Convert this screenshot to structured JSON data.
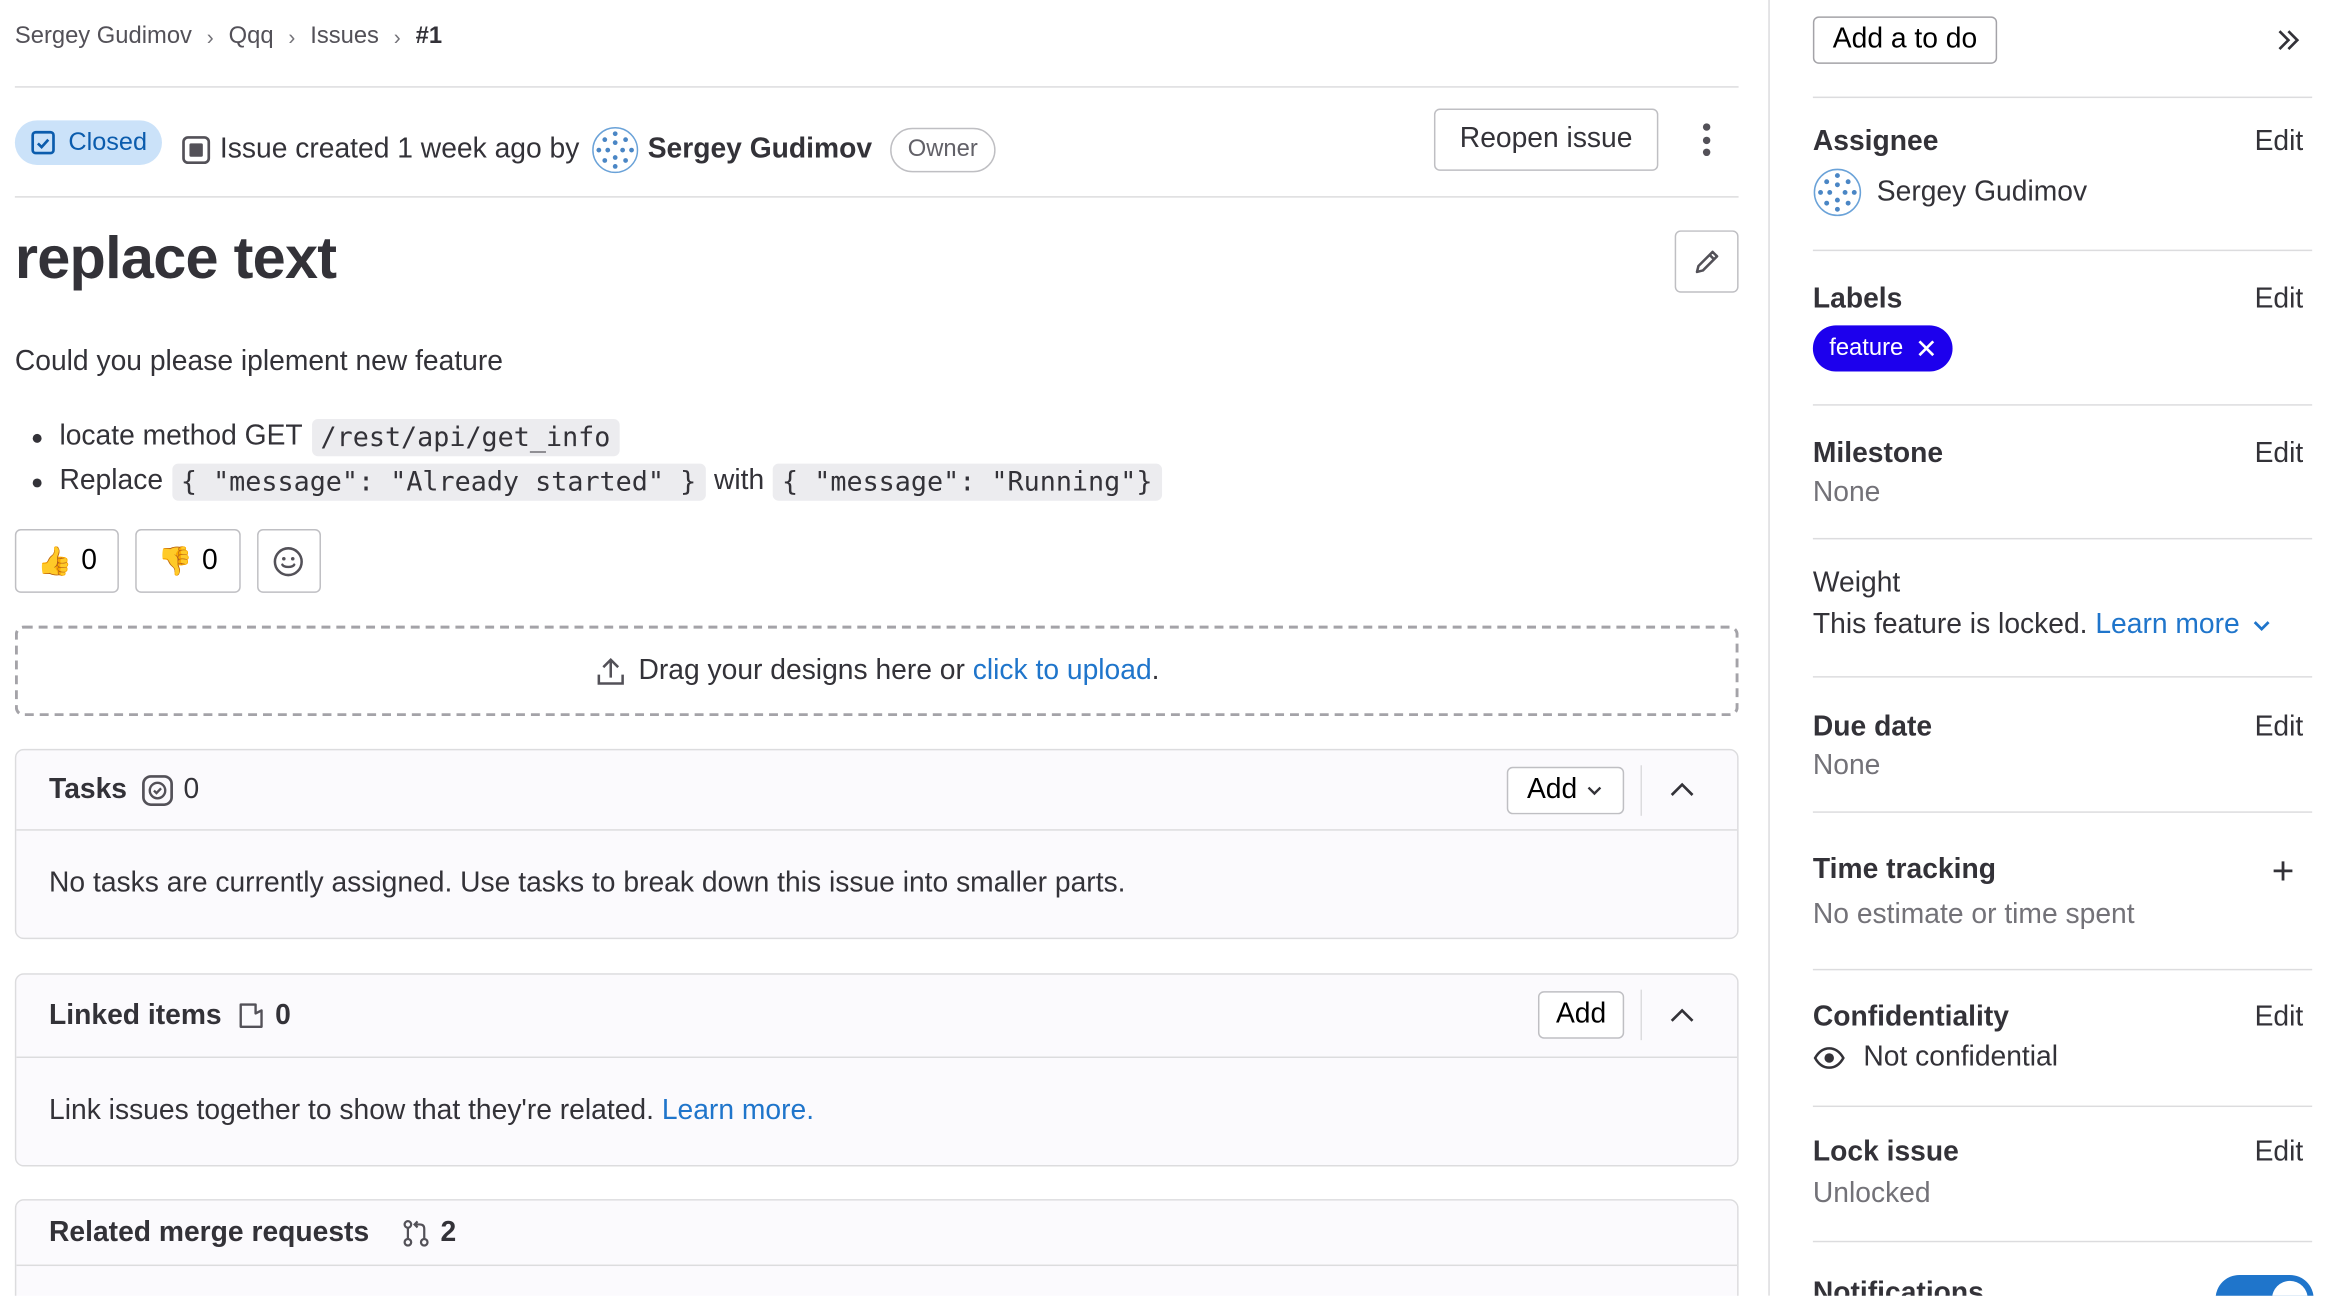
{
  "breadcrumb": {
    "items": [
      "Sergey Gudimov",
      "Qqq",
      "Issues"
    ],
    "current": "#1"
  },
  "issue": {
    "status": "Closed",
    "created_text": "Issue created 1 week ago by",
    "author": "Sergey Gudimov",
    "author_role": "Owner",
    "reopen_label": "Reopen issue",
    "title": "replace text",
    "description": "Could you please iplement new feature",
    "bullet1_prefix": "locate method GET",
    "bullet1_code": "/rest/api/get_info",
    "bullet2_prefix": "Replace",
    "bullet2_code1": "{ \"message\": \"Already started\" }",
    "bullet2_mid": "with",
    "bullet2_code2": "{ \"message\": \"Running\"}",
    "thumbs_up_count": "0",
    "thumbs_down_count": "0"
  },
  "designs": {
    "text": "Drag your designs here or",
    "link": "click to upload",
    "suffix": "."
  },
  "tasks": {
    "title": "Tasks",
    "count": "0",
    "add_label": "Add",
    "empty_text": "No tasks are currently assigned. Use tasks to break down this issue into smaller parts."
  },
  "linked": {
    "title": "Linked items",
    "count": "0",
    "add_label": "Add",
    "text": "Link issues together to show that they're related.",
    "link": "Learn more."
  },
  "merge_requests": {
    "title": "Related merge requests",
    "count": "2"
  },
  "sidebar": {
    "todo_label": "Add a to do",
    "edit_label": "Edit",
    "assignee": {
      "title": "Assignee",
      "name": "Sergey Gudimov"
    },
    "labels": {
      "title": "Labels",
      "label": "feature",
      "label_color": "#1d00ed"
    },
    "milestone": {
      "title": "Milestone",
      "value": "None"
    },
    "weight": {
      "title": "Weight",
      "text": "This feature is locked.",
      "link": "Learn more"
    },
    "due_date": {
      "title": "Due date",
      "value": "None"
    },
    "time_tracking": {
      "title": "Time tracking",
      "value": "No estimate or time spent"
    },
    "confidentiality": {
      "title": "Confidentiality",
      "value": "Not confidential"
    },
    "lock": {
      "title": "Lock issue",
      "value": "Unlocked"
    },
    "notifications": {
      "title": "Notifications",
      "enabled": true
    }
  },
  "colors": {
    "accent": "#1f75cb",
    "closed_badge_bg": "#cbe2f9",
    "closed_badge_text": "#0b5cad"
  }
}
